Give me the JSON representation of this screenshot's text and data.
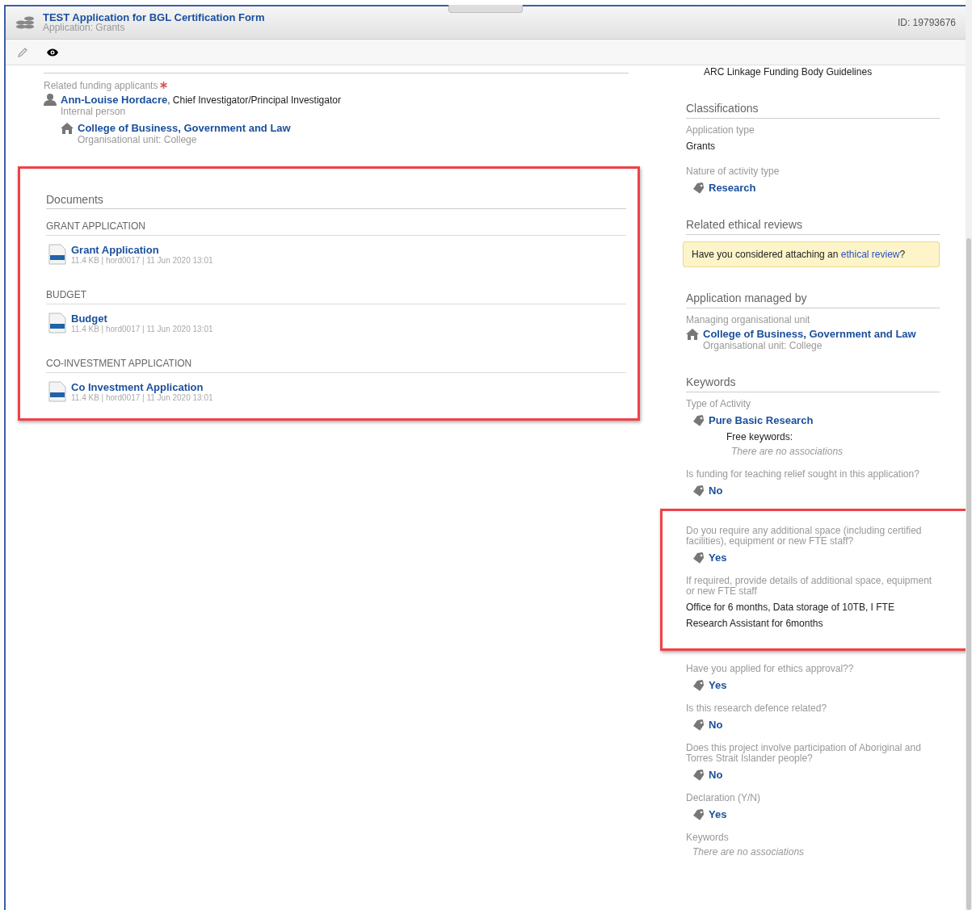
{
  "header": {
    "title": "TEST Application for BGL Certification Form",
    "subtitle": "Application: Grants",
    "id": "ID: 19793676"
  },
  "toolbar": {
    "tools": [
      {
        "kind": "edit",
        "selected": false
      },
      {
        "kind": "view",
        "selected": true
      }
    ]
  },
  "applicants": {
    "label": "Related funding applicants",
    "required": true,
    "person": {
      "name": "Ann-Louise Hordacre",
      "role": ", Chief Investigator/Principal Investigator",
      "type": "Internal person"
    },
    "unit": {
      "name": "College of Business, Government and Law",
      "type": "Organisational unit: College"
    }
  },
  "documents": {
    "title": "Documents",
    "highlighted": true,
    "groups": [
      {
        "heading": "GRANT APPLICATION",
        "files": [
          {
            "name": "Grant Application",
            "meta": "11.4 KB | hord0017 | 11 Jun 2020 13:01"
          }
        ]
      },
      {
        "heading": "BUDGET",
        "files": [
          {
            "name": "Budget",
            "meta": "11.4 KB | hord0017 | 11 Jun 2020 13:01"
          }
        ]
      },
      {
        "heading": "CO-INVESTMENT APPLICATION",
        "files": [
          {
            "name": "Co Investment Application",
            "meta": "11.4 KB | hord0017 | 11 Jun 2020 13:01"
          }
        ]
      }
    ]
  },
  "guidelines": "ARC Linkage Funding Body Guidelines",
  "sections": [
    {
      "title": "Classifications",
      "fields": [
        {
          "kind": "text",
          "label": "Application type",
          "value": "Grants"
        },
        {
          "kind": "tag",
          "label": "Nature of activity type",
          "value": "Research"
        }
      ]
    },
    {
      "title": "Related ethical reviews",
      "fields": [
        {
          "kind": "notice",
          "text": "Have you considered attaching an ",
          "link": "ethical review",
          "suffix": "?"
        }
      ]
    },
    {
      "title": "Application managed by",
      "fields": [
        {
          "kind": "unit",
          "label": "Managing organisational unit",
          "value": "College of Business, Government and Law",
          "type": "Organisational unit: College"
        }
      ]
    },
    {
      "title": "Keywords",
      "fields": [
        {
          "kind": "tag",
          "label": "Type of Activity",
          "value": "Pure Basic Research",
          "sublabel": "Free keywords:",
          "empty": "There are no associations"
        },
        {
          "kind": "tag",
          "label": "Is funding for teaching relief sought in this application?",
          "value": "No"
        },
        {
          "kind": "group",
          "highlighted": true,
          "fields": [
            {
              "kind": "tag",
              "label": "Do you require any additional space (including certified facilities), equipment or new FTE staff?",
              "value": "Yes"
            },
            {
              "kind": "text",
              "label": "If required, provide details of additional space, equipment or new FTE staff",
              "value": "Office for 6 months, Data storage of 10TB, I FTE Research Assistant for 6months"
            }
          ]
        },
        {
          "kind": "tag",
          "label": "Have you applied for ethics approval??",
          "value": "Yes"
        },
        {
          "kind": "tag",
          "label": "Is this research defence related?",
          "value": "No"
        },
        {
          "kind": "tag",
          "label": "Does this project involve participation of Aboriginal and Torres Strait Islander people?",
          "value": "No"
        },
        {
          "kind": "tag",
          "label": "Declaration (Y/N)",
          "value": "Yes"
        },
        {
          "kind": "empty",
          "label": "Keywords",
          "value": "There are no associations"
        }
      ]
    }
  ]
}
